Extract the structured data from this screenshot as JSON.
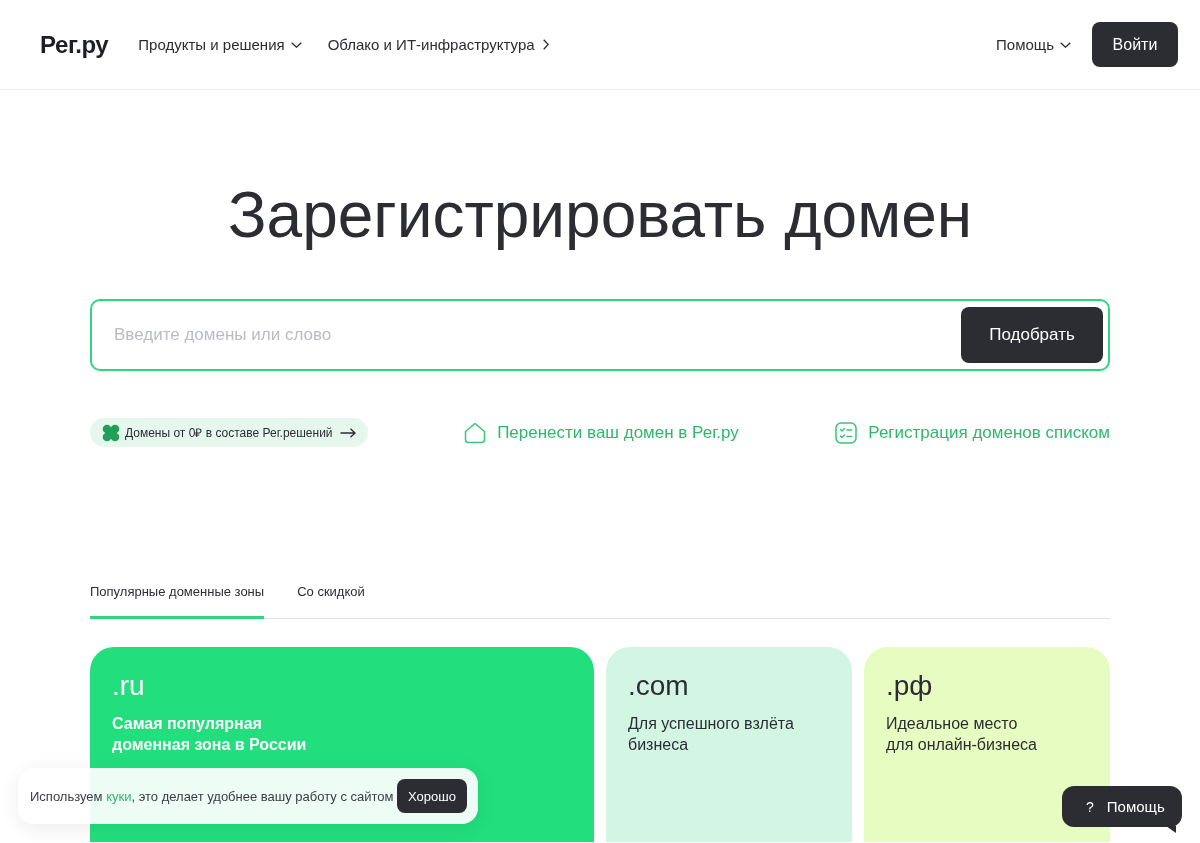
{
  "header": {
    "logo": "Рег.ру",
    "nav": [
      {
        "label": "Продукты и решения",
        "kind": "dropdown"
      },
      {
        "label": "Облако и ИТ-инфраструктура",
        "kind": "link"
      }
    ],
    "help_menu": {
      "label": "Помощь",
      "kind": "dropdown"
    },
    "login_button": "Войти"
  },
  "hero": {
    "title": "Зарегистрировать домен",
    "search": {
      "placeholder": "Введите домены или слово",
      "button": "Подобрать"
    },
    "promo": "Домены от 0₽ в составе Рег.решений",
    "links": [
      {
        "label": "Перенести ваш домен в Рег.ру",
        "kind": "transfer"
      },
      {
        "label": "Регистрация доменов списком",
        "kind": "bulk"
      }
    ]
  },
  "tabs": [
    {
      "label": "Популярные доменные зоны",
      "selected": true
    },
    {
      "label": "Со скидкой",
      "selected": false
    }
  ],
  "zones": [
    {
      "name": ".ru",
      "description": "Самая популярная\nдоменная зона в России",
      "kind": "wide",
      "color": "#22de7d"
    },
    {
      "name": ".com",
      "description": "Для успешного взлёта\nбизнеса",
      "kind": "narrow",
      "color": "#d2f5e4"
    },
    {
      "name": ".рф",
      "description": "Идеальное место\nдля онлайн-бизнеса",
      "kind": "narrow",
      "color": "#e6fcc0"
    }
  ],
  "cookie_banner": {
    "text_before": "Используем ",
    "link": "куки",
    "text_after": ", это делает удобнее вашу работу с сайтом",
    "button": "Хорошо"
  },
  "help_widget": {
    "icon": "?",
    "label": "Помощь"
  }
}
